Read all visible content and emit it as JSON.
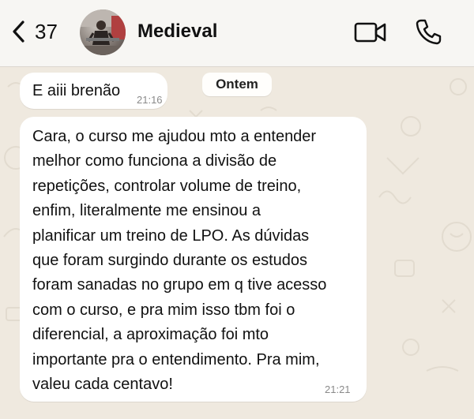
{
  "header": {
    "back_count": "37",
    "contact_name": "Medieval"
  },
  "messages": [
    {
      "text": "E aiii brenão",
      "time": "21:16"
    },
    {
      "lines": [
        "Cara, o curso me ajudou mto a entender",
        "melhor como funciona a divisão de",
        "repetições, controlar volume de treino,",
        "enfim, literalmente me ensinou a",
        "planificar um treino de LPO. As dúvidas",
        "que foram surgindo durante os estudos",
        "foram sanadas no grupo em q tive acesso",
        "com o curso, e pra mim isso tbm foi o",
        "diferencial, a aproximação foi mto",
        "importante pra o entendimento. Pra mim,",
        "valeu cada centavo!"
      ],
      "time": "21:21"
    }
  ],
  "date_chip": "Ontem",
  "colors": {
    "header_bg": "#f7f6f3",
    "wallpaper": "#efe9df",
    "bubble": "#ffffff",
    "timestamp": "#8a8a8a"
  },
  "icons": [
    "chevron-left-icon",
    "video-camera-icon",
    "phone-icon"
  ]
}
